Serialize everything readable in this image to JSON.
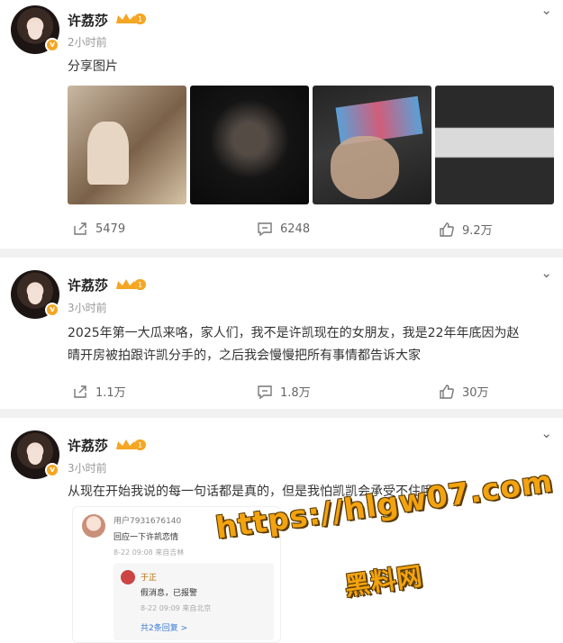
{
  "posts": [
    {
      "author": "许荔莎",
      "time": "2小时前",
      "text": "分享图片",
      "images": [
        "image-1",
        "image-2",
        "image-3",
        "image-4"
      ],
      "actions": {
        "share": "5479",
        "comment": "6248",
        "like": "9.2万"
      },
      "badge_level": "1"
    },
    {
      "author": "许荔莎",
      "time": "3小时前",
      "text_lines": [
        "2025年第一大瓜来咯，家人们，我不是许凯现在的女朋友，我是22年年底因为赵",
        "晴开房被拍跟许凯分手的，之后我会慢慢把所有事情都告诉大家"
      ],
      "actions": {
        "share": "1.1万",
        "comment": "1.8万",
        "like": "30万"
      },
      "badge_level": "1"
    },
    {
      "author": "许荔莎",
      "time": "3小时前",
      "text": "从现在开始我说的每一句话都是真的，但是我怕凯凯会承受不住哦",
      "badge_level": "1",
      "embedded_comment": {
        "user": "用户7931676140",
        "message": "回应一下许凯恋情",
        "meta": "8-22 09:08 来自吉林",
        "reply_user": "于正",
        "reply_message": "假消息，已报警",
        "reply_meta": "8-22 09:09 来自北京",
        "more_replies": "共2条回复 >"
      }
    }
  ],
  "watermark": {
    "url": "https://hlgw07.com",
    "name": "黑料网"
  },
  "colors": {
    "accent_orange": "#f5a623",
    "watermark_orange": "#f2a30f",
    "link_blue": "#3a7bd5"
  },
  "icons": [
    "share-icon",
    "comment-icon",
    "like-icon",
    "chevron-down-icon",
    "crown-badge-icon",
    "verified-badge-icon"
  ]
}
